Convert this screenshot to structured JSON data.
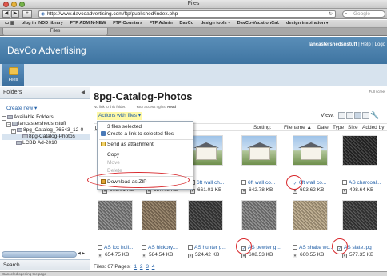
{
  "browser": {
    "window_title": "Files",
    "url": "http://www.davcoadvertising.com/ftp/published/index.php",
    "search_placeholder": "Google",
    "bookmarks": [
      "plug in INDD library",
      "FTP ADMIN-NEW",
      "FTP-Counters",
      "FTP Admin",
      "DavCo",
      "design tools ▾",
      "DavCo-VacationCal.",
      "design inspiration ▾"
    ],
    "tab_label": "Files",
    "status_text": "Canceled opening the page"
  },
  "header": {
    "brand": "DavCo Advertising",
    "username": "lancastershedsnstuff",
    "help": "Help",
    "logout": "Logo"
  },
  "iconstrip": {
    "files_label": "Files"
  },
  "sidebar": {
    "title": "Folders",
    "create_new": "Create new ▾",
    "tree": [
      {
        "label": "Available Folders",
        "toggle": "−"
      },
      {
        "label": "lancastershedsnstuff",
        "toggle": "−"
      },
      {
        "label": "8pg_Catalog_76543_12-0",
        "toggle": "−"
      },
      {
        "label": "8pg-Catalog-Photos",
        "toggle": ""
      },
      {
        "label": "LCBD Ad-2010",
        "toggle": ""
      }
    ],
    "search_label": "Search"
  },
  "main": {
    "title": "8pg-Catalog-Photos",
    "no_link": "No link to this folder.",
    "access_rights_prefix": "Your access rights:",
    "access_rights_value": "Read",
    "full_screen": "Full scree",
    "actions_label": "Actions with files ▾",
    "view_label": "View:",
    "sort": {
      "sorting": "Sorting:",
      "filename": "Filename ▲",
      "date": "Date",
      "type": "Type",
      "size": "Size",
      "added_by": "Added by"
    },
    "files_row1": [
      {
        "name": "",
        "size": "608.01 KB",
        "checked": false
      },
      {
        "name": "",
        "size": "537.78 KB",
        "checked": false
      },
      {
        "name": "6ft wall ch...",
        "size": "661.01 KB",
        "checked": false
      },
      {
        "name": "6ft wall co...",
        "size": "642.78 KB",
        "checked": false
      },
      {
        "name": "6ft wall co...",
        "size": "693.62 KB",
        "checked": true
      },
      {
        "name": "AS charcoal...",
        "size": "498.64 KB",
        "checked": false
      }
    ],
    "files_row2": [
      {
        "name": "AS fox holl...",
        "size": "654.75 KB",
        "checked": false
      },
      {
        "name": "AS hickory....",
        "size": "584.54 KB",
        "checked": false
      },
      {
        "name": "AS hunter g...",
        "size": "524.42 KB",
        "checked": false
      },
      {
        "name": "AS pewter g...",
        "size": "608.53 KB",
        "checked": true
      },
      {
        "name": "AS shake wo...",
        "size": "660.55 KB",
        "checked": false
      },
      {
        "name": "AS slate.jpg",
        "size": "577.35 KB",
        "checked": true
      }
    ],
    "pager_label": "Files: 67",
    "pages_label": "Pages:",
    "pages": [
      "1",
      "2",
      "3",
      "4"
    ]
  },
  "menu": {
    "items": [
      {
        "label": "3 files selected",
        "disabled": false
      },
      {
        "label": "Create a link to selected files",
        "disabled": false
      },
      {
        "label": "Send as attachment",
        "disabled": false
      },
      {
        "label": "Copy",
        "disabled": false
      },
      {
        "label": "Move",
        "disabled": true
      },
      {
        "label": "Delete",
        "disabled": true
      },
      {
        "label": "Download as ZIP",
        "disabled": false
      }
    ]
  },
  "colors": {
    "header_blue": "#3e74a1",
    "link_blue": "#2461a8",
    "highlight_yellow": "#fff9a6",
    "annotation_red": "#d8282c"
  }
}
